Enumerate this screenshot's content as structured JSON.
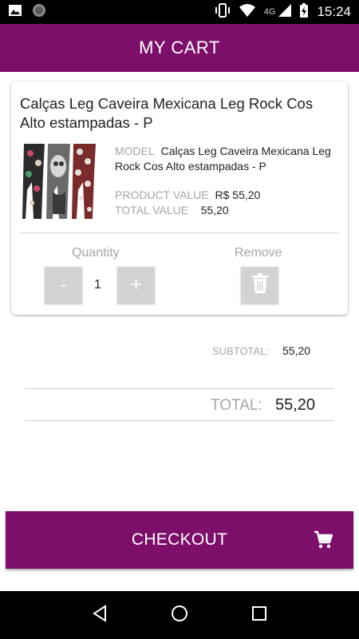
{
  "status_bar": {
    "network": "4G",
    "time": "15:24",
    "icons": [
      "image-icon",
      "circle-app-icon",
      "vibrate-icon",
      "wifi-icon",
      "signal-icon",
      "battery-charging-icon"
    ]
  },
  "header": {
    "title": "MY CART"
  },
  "cart_item": {
    "title": "Calças Leg Caveira Mexicana Leg Rock Cos Alto estampadas - P",
    "model_label": "MODEL",
    "model_value": "Calças Leg Caveira Mexicana Leg Rock Cos Alto estampadas - P",
    "product_value_label": "PRODUCT VALUE",
    "product_value": "R$ 55,20",
    "total_value_label": "TOTAL VALUE",
    "total_value": "55,20",
    "quantity_label": "Quantity",
    "quantity": "1",
    "minus_label": "-",
    "plus_label": "+",
    "remove_label": "Remove"
  },
  "summary": {
    "subtotal_label": "SUBTOTAL:",
    "subtotal_value": "55,20",
    "total_label": "TOTAL:",
    "total_value": "55,20"
  },
  "checkout": {
    "label": "CHECKOUT",
    "icon": "cart-icon"
  },
  "nav": {
    "icons": [
      "back-icon",
      "home-icon",
      "recents-icon"
    ]
  },
  "colors": {
    "primary": "#7d0f6b",
    "muted_text": "#a6a6a6",
    "button_grey": "#d3d3d3"
  }
}
